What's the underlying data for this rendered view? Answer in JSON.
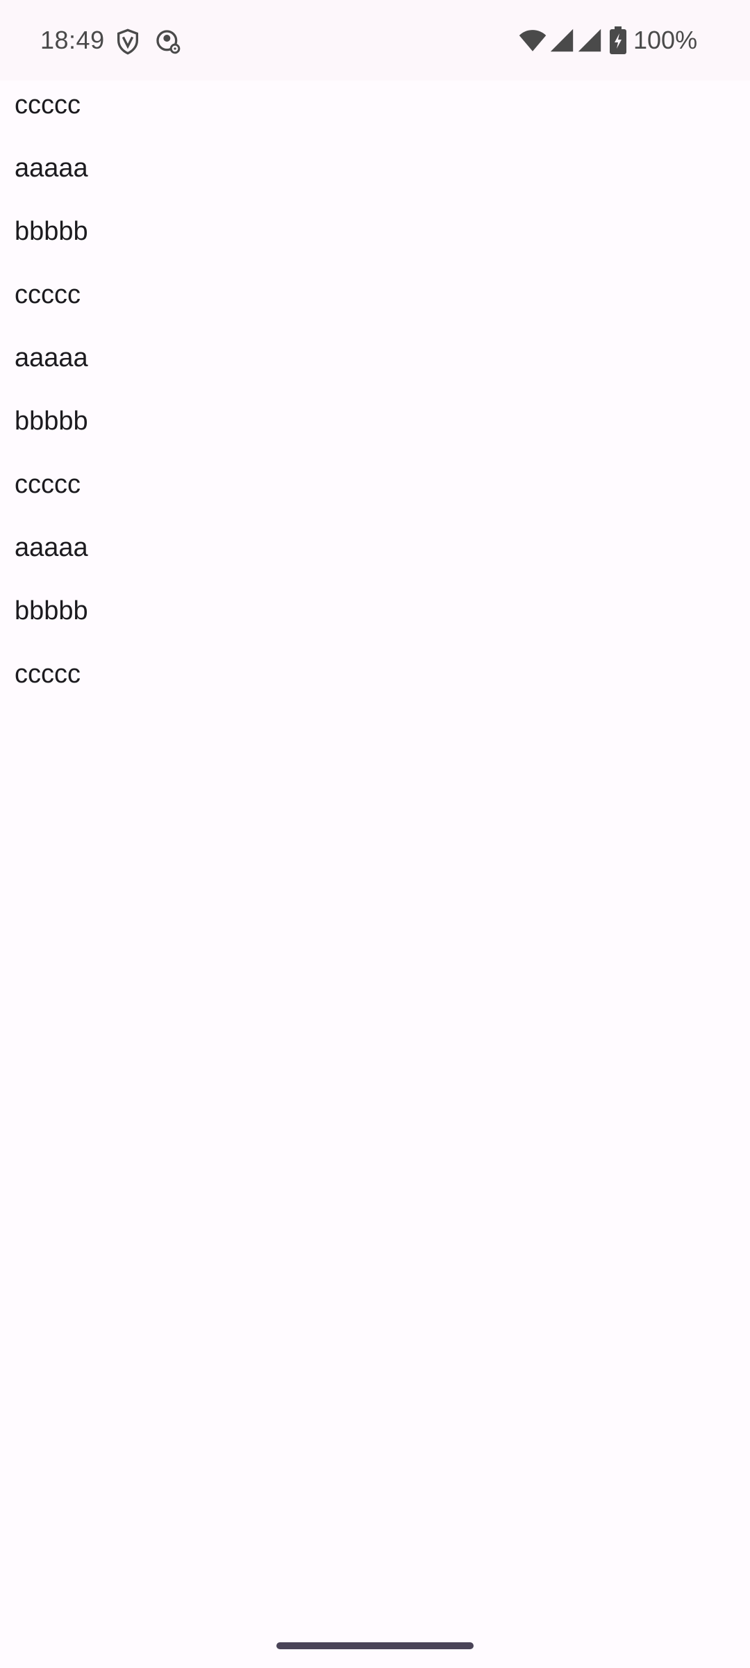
{
  "status_bar": {
    "time": "18:49",
    "battery_percent": "100%",
    "icons": [
      "shield-v-icon",
      "account-settings-icon",
      "wifi-icon",
      "signal-icon",
      "signal-icon",
      "battery-charging-icon"
    ]
  },
  "list": {
    "items": [
      {
        "label": "ccccc"
      },
      {
        "label": "aaaaa"
      },
      {
        "label": "bbbbb"
      },
      {
        "label": "ccccc"
      },
      {
        "label": "aaaaa"
      },
      {
        "label": "bbbbb"
      },
      {
        "label": "ccccc"
      },
      {
        "label": "aaaaa"
      },
      {
        "label": "bbbbb"
      },
      {
        "label": "ccccc"
      }
    ]
  },
  "colors": {
    "background": "#fffbff",
    "status_bar_background": "#fdf7fb",
    "text": "#1c1b1f",
    "status_text": "#4a4a4a"
  }
}
